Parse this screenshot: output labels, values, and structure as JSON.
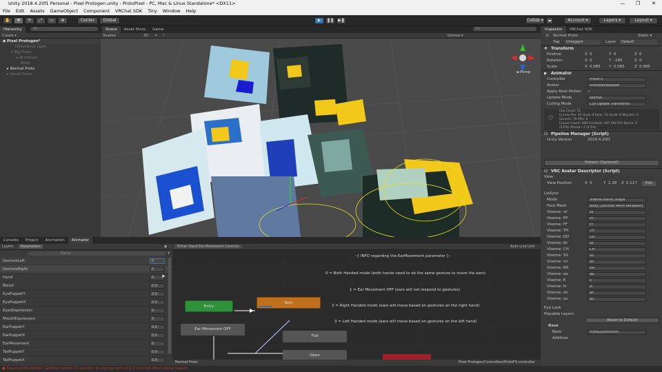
{
  "window": {
    "title": "Unity 2018.4.20f1 Personal - Pixel Protogen.unity - ProtoPixel - PC, Mac & Linux Standalone* <DX11>",
    "minimize": "—",
    "maximize": "❐",
    "close": "✕"
  },
  "menu": [
    "File",
    "Edit",
    "Assets",
    "GameObject",
    "Component",
    "VRChat SDK",
    "Tiny",
    "Window",
    "Help"
  ],
  "toolbar": {
    "pivot": "Center",
    "space": "Global",
    "collab": "Collab ▾",
    "account": "Account ▾",
    "layers": "Layers ▾",
    "layout": "Layout ▾"
  },
  "hierarchy": {
    "tab": "Hierarchy",
    "create": "Create ▾",
    "search_placeholder": "All",
    "scene": "Pixel Protogen*",
    "items": [
      "Directional Light",
      "Big Proto",
      "Armature",
      "Body",
      "Normal Proto",
      "Small Proto"
    ]
  },
  "scene_view": {
    "tabs": [
      "Scene",
      "Asset Store",
      "Game"
    ],
    "shading": "Shaded",
    "mode_2d": "2D",
    "gizmos": "Gizmos ▾",
    "search_placeholder": "All",
    "persp": "◄ Persp"
  },
  "animator": {
    "tabs": [
      "Console",
      "Project",
      "Animation",
      "Animator"
    ],
    "subtabs": [
      "Layers",
      "Parameters"
    ],
    "search_placeholder": "Name",
    "breadcrumb": "Either Hand Ear Movement Controls",
    "auto_live": "Auto Live Link",
    "parameters": [
      {
        "name": "GestureLeft",
        "value": "0"
      },
      {
        "name": "GestureRight",
        "value": "0"
      },
      {
        "name": "Hand",
        "value": "0"
      },
      {
        "name": "Blend",
        "value": "0.0"
      },
      {
        "name": "EyePuppetY",
        "value": "0.0"
      },
      {
        "name": "EyePuppetX",
        "value": "0.0"
      },
      {
        "name": "EyesExpression",
        "value": "0"
      },
      {
        "name": "MouthExpression",
        "value": "0"
      },
      {
        "name": "EarPuppetY",
        "value": "0.0"
      },
      {
        "name": "EarPuppetX",
        "value": "0.0"
      },
      {
        "name": "EarMovement",
        "value": "0"
      },
      {
        "name": "TailPuppetY",
        "value": "0.0"
      },
      {
        "name": "TailPuppetX",
        "value": "0.0"
      }
    ],
    "nodes": {
      "entry": "Entry",
      "rest": "Rest",
      "ear_off": "Ear Movement OFF",
      "flat": "Flat",
      "open": "Open"
    },
    "notes": [
      "--[ INFO regarding the EarMovement parameter ]--",
      "0 = Both Handed mode (both hands need to do the same gesture to move the ears)",
      "1 = Ear Movement OFF (ears will not respond to gestures)",
      "2 = Right Handed mode (ears will move based on gestures on the right hand)",
      "3 = Left Handed mode (ears will move based on gestures on the left hand)"
    ],
    "footer_left": "Normal Proto",
    "footer_right": "Pixel Protogen/Controllers/ProtoFX.controller"
  },
  "inspector": {
    "tabs": [
      "Inspector",
      "VRChat SDK"
    ],
    "object_name": "Normal Proto",
    "static": "Static ▾",
    "tag_label": "Tag",
    "tag": "Untagged",
    "layer_label": "Layer",
    "layer": "Default",
    "transform": {
      "header": "Transform",
      "position": {
        "label": "Position",
        "x": "0",
        "y": "0",
        "z": "0"
      },
      "rotation": {
        "label": "Rotation",
        "x": "0",
        "y": "-180",
        "z": "0"
      },
      "scale": {
        "label": "Scale",
        "x": "0.085",
        "y": "0.085",
        "z": "0.085"
      }
    },
    "animator": {
      "header": "Animator",
      "rows": [
        {
          "label": "Controller",
          "value": "ProtoFX"
        },
        {
          "label": "Avatar",
          "value": "ProtoBlendAvatar"
        },
        {
          "label": "Apply Root Motion",
          "value": "✓"
        },
        {
          "label": "Update Mode",
          "value": "Normal"
        },
        {
          "label": "Culling Mode",
          "value": "Cull Update Transforms"
        }
      ],
      "info": [
        "Clip Count: 55",
        "Curves Pos: 53 Quat: 0 Euler: 52 Scale: 6 Muscles: 0",
        "Generic: 70 PPtr: 0",
        "Curves Count: 409 Constant: 407 (99.5%) Dense: 0",
        "(0.0%) Stream: 2 (0.5%)"
      ]
    },
    "pipeline": {
      "header": "Pipeline Manager (Script)",
      "unity_version_label": "Unity Version",
      "unity_version": "2018.4.20f1",
      "detach": "Detach (Optional)"
    },
    "descriptor": {
      "header": "VRC Avatar Descriptor (Script)",
      "view": "View",
      "view_position_label": "View Position",
      "vx": "0",
      "vy": "1.38",
      "vz": "0.117",
      "edit": "Edit",
      "lipsync": "LipSync",
      "mode_label": "Mode",
      "mode": "Viseme Blend Shape",
      "face_mesh_label": "Face Mesh",
      "face_mesh": "Body (Skinned Mesh Renderer)",
      "visemes": [
        {
          "label": "Viseme: sil",
          "value": "sil"
        },
        {
          "label": "Viseme: PP",
          "value": "PP"
        },
        {
          "label": "Viseme: FF",
          "value": "FF"
        },
        {
          "label": "Viseme: TH",
          "value": "TH"
        },
        {
          "label": "Viseme: DD",
          "value": "DD"
        },
        {
          "label": "Viseme: kk",
          "value": "kk"
        },
        {
          "label": "Viseme: CH",
          "value": "CH"
        },
        {
          "label": "Viseme: SS",
          "value": "SS"
        },
        {
          "label": "Viseme: nn",
          "value": "nn"
        },
        {
          "label": "Viseme: RR",
          "value": "RR"
        },
        {
          "label": "Viseme: aa",
          "value": "aa"
        },
        {
          "label": "Viseme: E",
          "value": "E"
        },
        {
          "label": "Viseme: ih",
          "value": "ih"
        },
        {
          "label": "Viseme: oh",
          "value": "oh"
        },
        {
          "label": "Viseme: ou",
          "value": "ou"
        }
      ],
      "eye_look": "Eye Look",
      "playable_layers": "Playable Layers",
      "reset": "Reset to Default",
      "base": "Base",
      "base_label": "Base",
      "base_value": "ProtoLocomotion",
      "additive_label": "Additive"
    }
  },
  "status": "ArgumentException: Getting control 0's position in a group with only 0 controls when doing repaint",
  "colors": {
    "accent_blue": "#3a72b0",
    "entry_green": "#2f8f3a",
    "rest_orange": "#c0701c",
    "error_red": "#d03030"
  }
}
